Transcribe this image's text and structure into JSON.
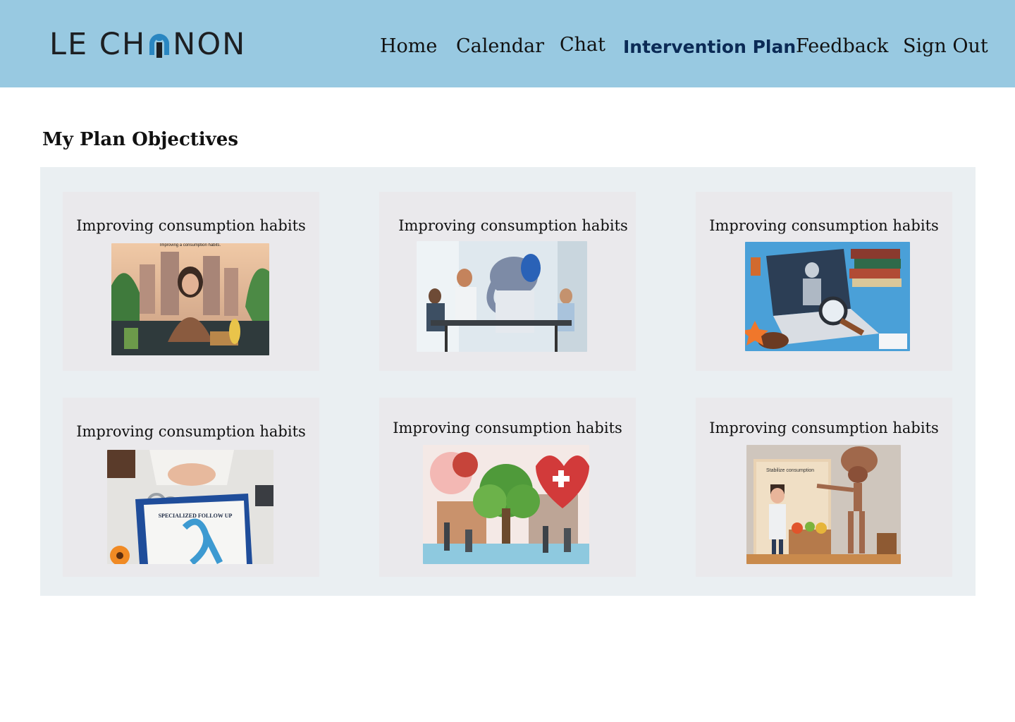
{
  "app": {
    "logo_text_left": "LE CH",
    "logo_text_right": "NON",
    "brand_colors": {
      "header_bg": "#98c9e1",
      "logo_accent": "#2a86c1",
      "active_nav": "#0b2a55"
    }
  },
  "nav": {
    "items": [
      {
        "label": "Home"
      },
      {
        "label": "Calendar"
      },
      {
        "label": "Chat"
      },
      {
        "label": "Intervention Plan",
        "active": true
      },
      {
        "label": "Feedback"
      },
      {
        "label": "Sign Out"
      }
    ]
  },
  "main": {
    "title": "My Plan Objectives",
    "cards": [
      {
        "title": "Improving consumption habits",
        "image": "woman-meditating-city-image",
        "image_caption": "Improving a consumption habits."
      },
      {
        "title": "Improving consumption habits",
        "image": "elephant-doctor-meeting-image"
      },
      {
        "title": "Improving consumption habits",
        "image": "laptop-legal-investigation-image"
      },
      {
        "title": "Improving consumption habits",
        "image": "clipboard-ribbon-handcuffs-image",
        "image_caption": "SPECIALIZED FOLLOW UP"
      },
      {
        "title": "Improving consumption habits",
        "image": "tree-heart-community-image"
      },
      {
        "title": "Improving consumption habits",
        "image": "skeleton-doctor-diorama-image",
        "image_caption": "Stabilize consumption"
      }
    ]
  }
}
